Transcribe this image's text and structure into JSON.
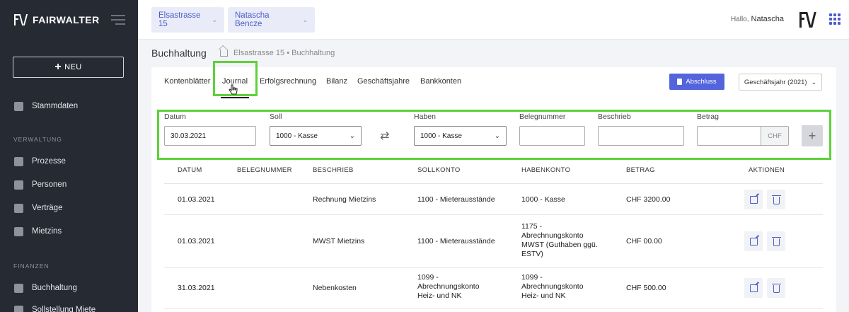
{
  "brand": {
    "name": "FAIRWALTER"
  },
  "sidebar": {
    "new_button": "NEU",
    "items": [
      {
        "label": "Stammdaten",
        "icon": "database-icon"
      },
      {
        "label": "Prozesse",
        "icon": "process-icon"
      },
      {
        "label": "Personen",
        "icon": "people-icon"
      },
      {
        "label": "Verträge",
        "icon": "contract-icon"
      },
      {
        "label": "Mietzins",
        "icon": "coins-icon"
      },
      {
        "label": "Buchhaltung",
        "icon": "ledger-icon"
      },
      {
        "label": "Sollstellung Miete",
        "icon": "invoice-icon"
      }
    ],
    "sections": {
      "verwaltung": "VERWALTUNG",
      "finanzen": "FINANZEN"
    }
  },
  "topbar": {
    "property": "Elsastrasse 15",
    "person": "Natascha Bencze",
    "greeting": "Hallo,",
    "user": "Natascha"
  },
  "breadcrumb": {
    "title": "Buchhaltung",
    "path": "Elsastrasse 15 • Buchhaltung"
  },
  "tabs": [
    "Kontenblätter",
    "Journal",
    "Erfolgsrechnung",
    "Bilanz",
    "Geschäftsjahre",
    "Bankkonten"
  ],
  "actions": {
    "abschluss": "Abschluss",
    "year": "Geschäftsjahr (2021)"
  },
  "form": {
    "datum_label": "Datum",
    "datum_value": "30.03.2021",
    "soll_label": "Soll",
    "soll_value": "1000 - Kasse",
    "haben_label": "Haben",
    "haben_value": "1000 - Kasse",
    "beleg_label": "Belegnummer",
    "beschrieb_label": "Beschrieb",
    "betrag_label": "Betrag",
    "currency": "CHF",
    "add": "+"
  },
  "table": {
    "headers": [
      "DATUM",
      "BELEGNUMMER",
      "BESCHRIEB",
      "SOLLKONTO",
      "HABENKONTO",
      "BETRAG",
      "AKTIONEN"
    ],
    "rows": [
      {
        "datum": "01.03.2021",
        "beleg": "",
        "beschrieb": "Rechnung Mietzins",
        "soll": [
          "1100 - Mieterausstände"
        ],
        "haben": [
          "1000 - Kasse"
        ],
        "betrag": "CHF 3200.00"
      },
      {
        "datum": "01.03.2021",
        "beleg": "",
        "beschrieb": "MWST Mietzins",
        "soll": [
          "1100 - Mieterausstände"
        ],
        "haben": [
          "1175 -",
          "Abrechnungskonto",
          "MWST (Guthaben ggü.",
          "ESTV)"
        ],
        "betrag": "CHF 00.00"
      },
      {
        "datum": "31.03.2021",
        "beleg": "",
        "beschrieb": "Nebenkosten",
        "soll": [
          "1099 -",
          "Abrechnungskonto",
          "Heiz- und NK"
        ],
        "haben": [
          "1099 -",
          "Abrechnungskonto",
          "Heiz- und NK"
        ],
        "betrag": "CHF 500.00"
      }
    ]
  },
  "colors": {
    "sidebar": "#252a33",
    "accent": "#5364dc",
    "highlight": "#5dd13a"
  }
}
